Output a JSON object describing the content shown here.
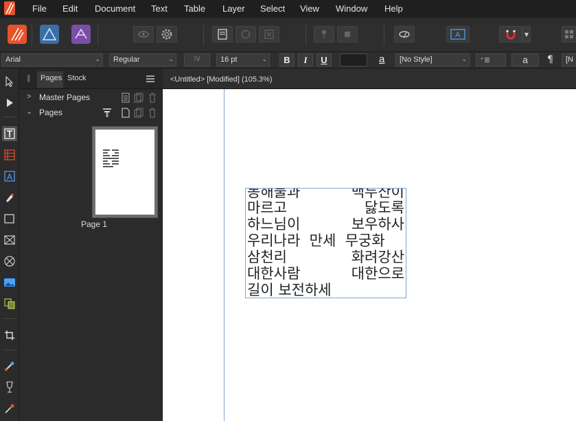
{
  "menu": [
    "File",
    "Edit",
    "Document",
    "Text",
    "Table",
    "Layer",
    "Select",
    "View",
    "Window",
    "Help"
  ],
  "context_bar": {
    "font_family": "Arial",
    "font_style": "Regular",
    "font_size": "16 pt",
    "bold": "B",
    "italic": "I",
    "underline": "U",
    "text_style": "[No Style]",
    "char_a": "a",
    "char_a2": "a",
    "pilcrow": "¶",
    "overflow_field": "[N"
  },
  "panel": {
    "tab_pages": "Pages",
    "tab_stock": "Stock",
    "master_pages": "Master Pages",
    "pages": "Pages",
    "page_label": "Page 1"
  },
  "document": {
    "title": "<Untitled> [Modified] (105.3%)"
  },
  "text_frame": {
    "lines": [
      {
        "left": "동해물과",
        "right": "백두산이"
      },
      {
        "left": "마르고",
        "right": "닳도록"
      },
      {
        "left": "하느님이",
        "right": "보우하사"
      },
      {
        "left": "우리나라  만세  무궁화",
        "right": ""
      },
      {
        "left": "삼천리",
        "right": "화려강산"
      },
      {
        "left": "대한사람",
        "right": "대한으로"
      },
      {
        "left": "길이 보전하세",
        "right": ""
      }
    ]
  },
  "colors": {
    "accent": "#e8522b",
    "guide": "#7aa7d6"
  }
}
